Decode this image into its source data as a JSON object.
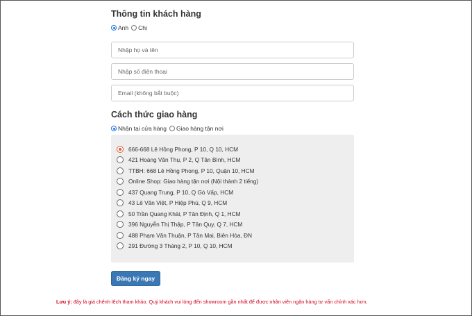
{
  "customer": {
    "title": "Thông tin khách hàng",
    "salutation_options": [
      {
        "label": "Anh",
        "checked": true
      },
      {
        "label": "Chị",
        "checked": false
      }
    ],
    "name_placeholder": "Nhập họ và tên",
    "phone_placeholder": "Nhập số điện thoại",
    "email_placeholder": "Email (không bắt buộc)"
  },
  "delivery": {
    "title": "Cách thức giao hàng",
    "method_options": [
      {
        "label": "Nhận tại cửa hàng",
        "checked": true
      },
      {
        "label": "Giao hàng tận nơi",
        "checked": false
      }
    ],
    "stores": [
      {
        "label": "666-668 Lê Hồng Phong, P 10, Q 10, HCM",
        "checked": true
      },
      {
        "label": "421 Hoàng Văn Thụ, P 2, Q Tân Bình, HCM",
        "checked": false
      },
      {
        "label": "TTBH: 668 Lê Hồng Phong, P 10, Quận 10, HCM",
        "checked": false
      },
      {
        "label": "Online Shop: Giao hàng tận nơi (Nội thành 2 tiếng)",
        "checked": false
      },
      {
        "label": "437 Quang Trung, P 10, Q Gò Vấp, HCM",
        "checked": false
      },
      {
        "label": "43 Lê Văn Việt, P Hiệp Phú, Q 9, HCM",
        "checked": false
      },
      {
        "label": "50 Trần Quang Khải, P Tân Định, Q 1, HCM",
        "checked": false
      },
      {
        "label": "396 Nguyễn Thị Thập, P Tân Quy, Q 7, HCM",
        "checked": false
      },
      {
        "label": "488 Phạm Văn Thuận, P Tân Mai, Biên Hòa, ĐN",
        "checked": false
      },
      {
        "label": "291 Đường 3 Tháng 2, P 10, Q 10, HCM",
        "checked": false
      }
    ]
  },
  "submit_label": "Đăng ký ngay",
  "note": {
    "prefix": "Lưu ý:",
    "text": " đây là giá chênh lệch tham khảo. Quý khách vui lòng đến showroom gần nhất để được nhân viên ngân hàng tư vấn chính xác hơn."
  },
  "colors": {
    "primary_button": "#3a78b5",
    "selected_store_radio": "#e25a3a",
    "note_text": "#d0021b",
    "panel_bg": "#eeeeee"
  }
}
